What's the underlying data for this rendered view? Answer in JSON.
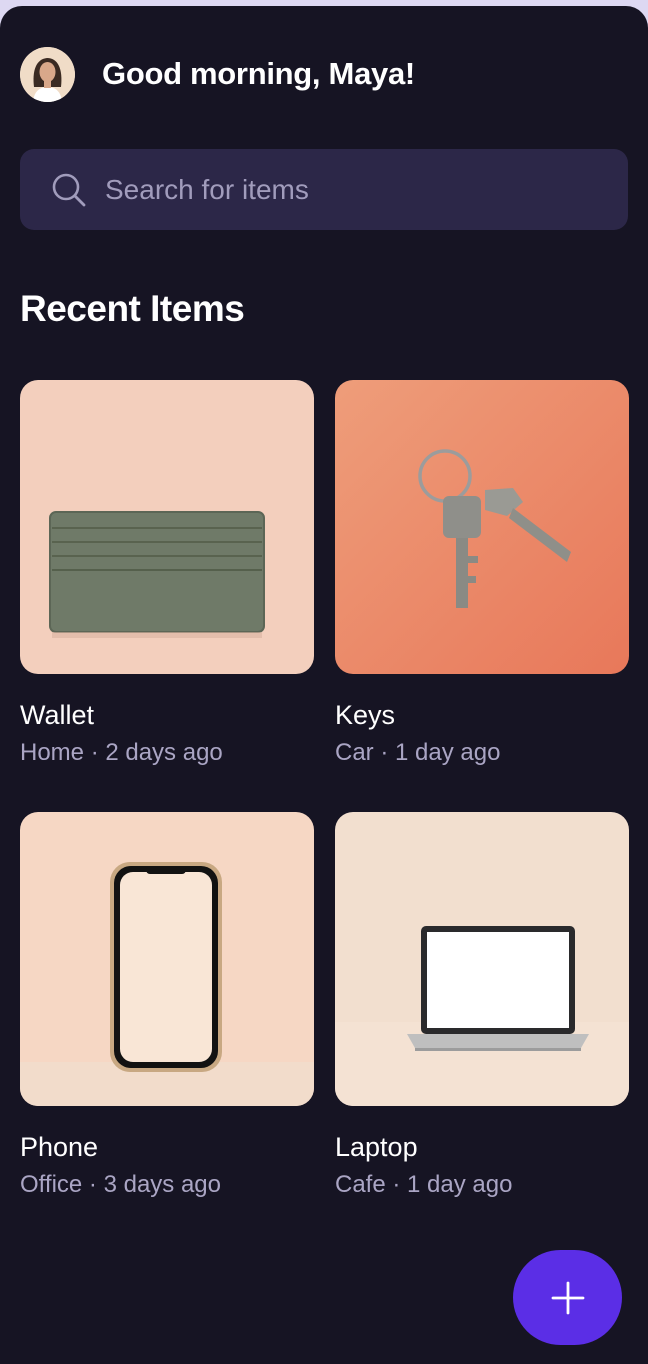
{
  "header": {
    "greeting": "Good morning, Maya!"
  },
  "search": {
    "placeholder": "Search for items"
  },
  "section": {
    "title": "Recent Items"
  },
  "items": [
    {
      "name": "Wallet",
      "meta": "Home · 2 days ago"
    },
    {
      "name": "Keys",
      "meta": "Car · 1 day ago"
    },
    {
      "name": "Phone",
      "meta": "Office · 3 days ago"
    },
    {
      "name": "Laptop",
      "meta": "Cafe · 1 day ago"
    }
  ],
  "icons": {
    "search": "search-icon",
    "fab": "plus-icon"
  },
  "colors": {
    "background": "#161423",
    "accent": "#5b2ee6",
    "search_bg": "#2c2748"
  }
}
